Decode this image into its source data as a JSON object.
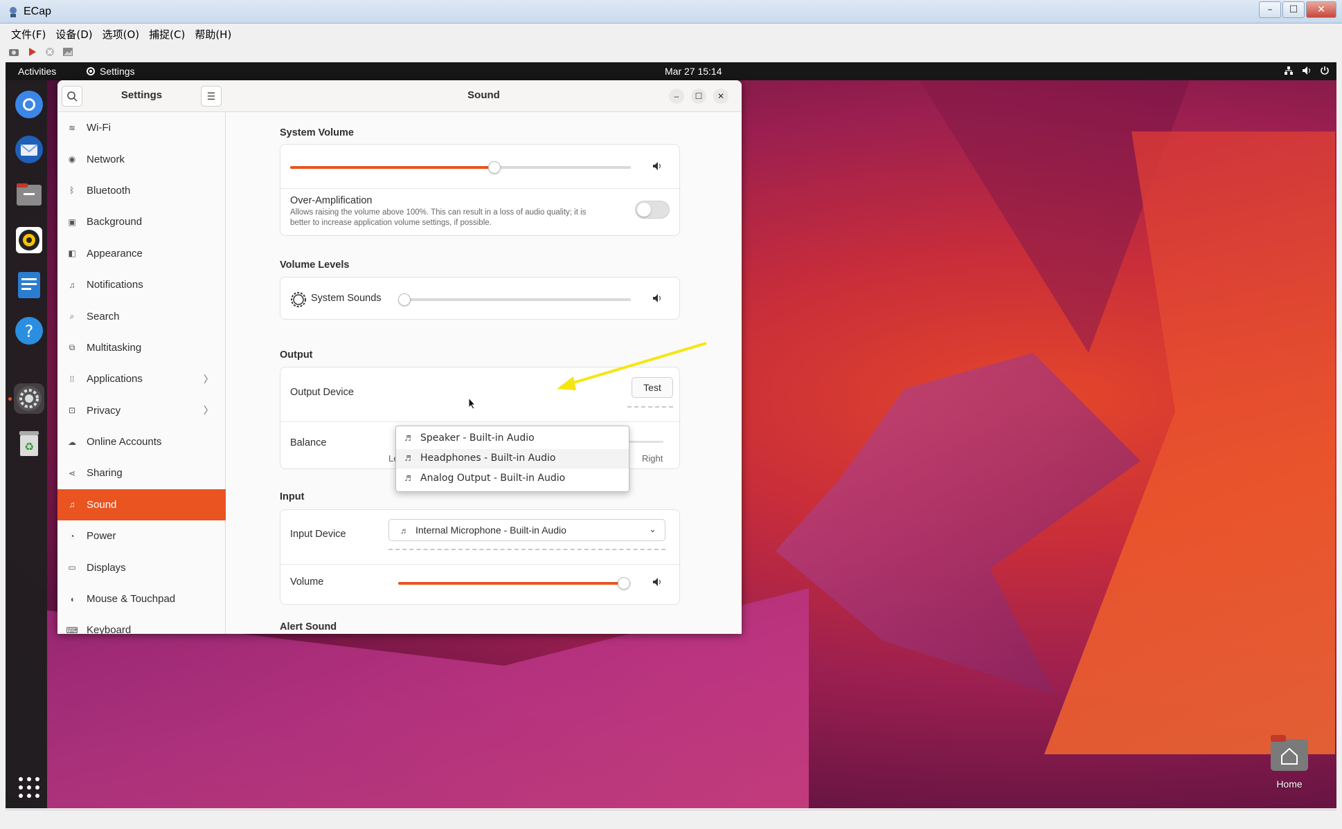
{
  "ecap": {
    "title": "ECap",
    "menu": [
      "文件(F)",
      "设备(D)",
      "选项(O)",
      "捕捉(C)",
      "帮助(H)"
    ],
    "window_buttons": [
      "–",
      "☐",
      "✕"
    ]
  },
  "topbar": {
    "activities": "Activities",
    "app_name": "Settings",
    "clock": "Mar 27  15:14"
  },
  "dock": {
    "items": [
      "chrome-icon",
      "thunderbird-icon",
      "files-icon",
      "rhythmbox-icon",
      "writer-icon",
      "help-icon",
      "settings-icon",
      "trash-icon",
      "app-grid-icon"
    ]
  },
  "settings": {
    "sidebar_title": "Settings",
    "page_title": "Sound",
    "sidebar": [
      {
        "label": "Wi-Fi",
        "icon": "wifi-icon"
      },
      {
        "label": "Network",
        "icon": "network-icon"
      },
      {
        "label": "Bluetooth",
        "icon": "bluetooth-icon"
      },
      {
        "label": "Background",
        "icon": "background-icon"
      },
      {
        "label": "Appearance",
        "icon": "appearance-icon"
      },
      {
        "label": "Notifications",
        "icon": "bell-icon"
      },
      {
        "label": "Search",
        "icon": "search-icon"
      },
      {
        "label": "Multitasking",
        "icon": "multitasking-icon"
      },
      {
        "label": "Applications",
        "icon": "applications-icon",
        "chevron": true
      },
      {
        "label": "Privacy",
        "icon": "lock-icon",
        "chevron": true
      },
      {
        "label": "Online Accounts",
        "icon": "cloud-icon"
      },
      {
        "label": "Sharing",
        "icon": "share-icon"
      },
      {
        "label": "Sound",
        "icon": "music-note-icon",
        "active": true
      },
      {
        "label": "Power",
        "icon": "power-icon"
      },
      {
        "label": "Displays",
        "icon": "display-icon"
      },
      {
        "label": "Mouse & Touchpad",
        "icon": "mouse-icon"
      },
      {
        "label": "Keyboard",
        "icon": "keyboard-icon"
      }
    ],
    "system_volume": {
      "heading": "System Volume",
      "level": 0.6,
      "over_amp_title": "Over-Amplification",
      "over_amp_desc_line1": "Allows raising the volume above 100%. This can result in a loss of audio quality; it is",
      "over_amp_desc_line2": "better to increase application volume settings, if possible.",
      "over_amp_enabled": false
    },
    "volume_levels": {
      "heading": "Volume Levels",
      "system_sounds_label": "System Sounds",
      "system_sounds_level": 0.0
    },
    "output": {
      "heading": "Output",
      "device_label": "Output Device",
      "test_label": "Test",
      "balance_label": "Balance",
      "balance_left": "Left",
      "balance_right": "Right",
      "balance_value": 0.5,
      "dropdown_options": [
        "Speaker - Built-in Audio",
        "Headphones - Built-in Audio",
        "Analog Output - Built-in Audio"
      ]
    },
    "input": {
      "heading": "Input",
      "device_label": "Input Device",
      "device_value": "Internal Microphone - Built-in Audio",
      "volume_label": "Volume",
      "volume_level": 0.97
    },
    "alert_sound": {
      "heading": "Alert Sound"
    }
  },
  "desktop": {
    "home_label": "Home"
  },
  "colors": {
    "accent": "#e95420",
    "topbar": "#171717"
  }
}
